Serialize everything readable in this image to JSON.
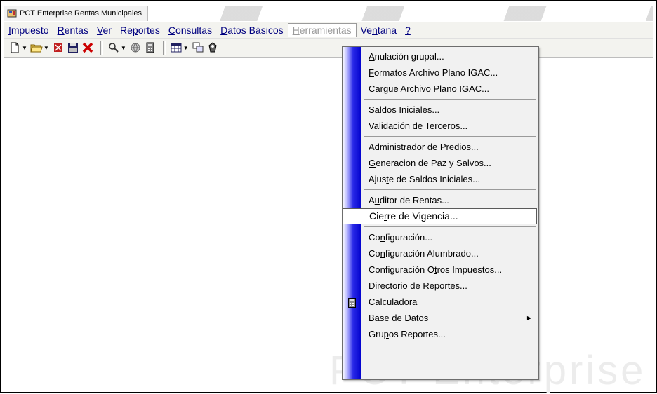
{
  "window": {
    "title": "PCT Enterprise Rentas Municipales",
    "watermark": "PCT Enterprise"
  },
  "menubar": [
    {
      "pre": "",
      "u": "I",
      "post": "mpuesto",
      "name": "menu-impuesto"
    },
    {
      "pre": "",
      "u": "R",
      "post": "entas",
      "name": "menu-rentas"
    },
    {
      "pre": "",
      "u": "V",
      "post": "er",
      "name": "menu-ver"
    },
    {
      "pre": "Re",
      "u": "p",
      "post": "ortes",
      "name": "menu-reportes"
    },
    {
      "pre": "",
      "u": "C",
      "post": "onsultas",
      "name": "menu-consultas"
    },
    {
      "pre": "",
      "u": "D",
      "post": "atos Básicos",
      "name": "menu-datos-basicos"
    },
    {
      "pre": "",
      "u": "H",
      "post": "erramientas",
      "name": "menu-herramientas"
    },
    {
      "pre": "Ve",
      "u": "n",
      "post": "tana",
      "name": "menu-ventana"
    },
    {
      "pre": "",
      "u": "?",
      "post": "",
      "name": "menu-help"
    }
  ],
  "active_menu": "Herramientas",
  "dropdown": {
    "items": [
      {
        "pre": "",
        "u": "A",
        "post": "nulación grupal...",
        "sep_after": false
      },
      {
        "pre": "",
        "u": "F",
        "post": "ormatos Archivo Plano IGAC...",
        "sep_after": false
      },
      {
        "pre": "",
        "u": "C",
        "post": "argue Archivo Plano IGAC...",
        "sep_after": true
      },
      {
        "pre": "",
        "u": "S",
        "post": "aldos Iniciales...",
        "sep_after": false
      },
      {
        "pre": "",
        "u": "V",
        "post": "alidación de Terceros...",
        "sep_after": true
      },
      {
        "pre": "A",
        "u": "d",
        "post": "ministrador de Predios...",
        "sep_after": false
      },
      {
        "pre": "",
        "u": "G",
        "post": "eneracion de Paz y Salvos...",
        "sep_after": false
      },
      {
        "pre": "Ajus",
        "u": "t",
        "post": "e de Saldos Iniciales...",
        "sep_after": true
      },
      {
        "pre": "A",
        "u": "u",
        "post": "ditor de Rentas...",
        "sep_after": false
      },
      {
        "pre": "Cie",
        "u": "r",
        "post": "re de Vigencia...",
        "sep_after": true,
        "selected": true
      },
      {
        "pre": "Co",
        "u": "n",
        "post": "figuración...",
        "sep_after": false
      },
      {
        "pre": "Co",
        "u": "n",
        "post": "figuración Alumbrado...",
        "sep_after": false
      },
      {
        "pre": "Configuración O",
        "u": "t",
        "post": "ros Impuestos...",
        "sep_after": false
      },
      {
        "pre": "D",
        "u": "i",
        "post": "rectorio de Reportes...",
        "sep_after": false
      },
      {
        "pre": "Ca",
        "u": "l",
        "post": "culadora",
        "sep_after": false,
        "icon": "calculator-icon"
      },
      {
        "pre": "",
        "u": "B",
        "post": "ase de Datos",
        "sep_after": false,
        "submenu": true
      },
      {
        "pre": "Gru",
        "u": "p",
        "post": "os Reportes...",
        "sep_after": false
      }
    ]
  },
  "toolbar_icons": [
    "new-document-icon",
    "open-folder-icon",
    "delete-icon",
    "save-icon",
    "close-x-icon",
    "search-person-icon",
    "globe-icon",
    "calculator-icon",
    "grid-icon",
    "copy-window-icon",
    "wizard-icon"
  ],
  "colors": {
    "menu_text": "#000080",
    "gutter": "#0000cc",
    "close_x": "#cc0000"
  }
}
